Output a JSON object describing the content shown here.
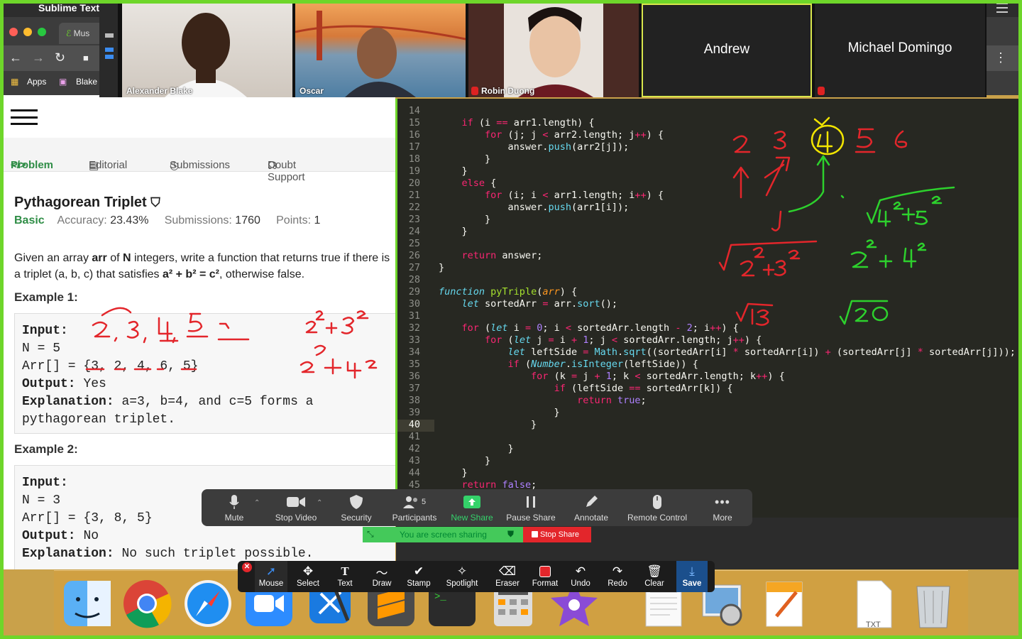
{
  "menubar": {
    "app_name": "Sublime Text"
  },
  "browser": {
    "tab_label_icon": "tab-icon",
    "tab_label": "Mus",
    "bookmarks": [
      "Apps",
      "Blake"
    ]
  },
  "participants": [
    {
      "name": "Alexander Blake",
      "video": true,
      "muted": false
    },
    {
      "name": "Oscar",
      "video": true,
      "muted": false
    },
    {
      "name": "Robin Duong",
      "video": true,
      "muted": true
    },
    {
      "name": "Andrew",
      "video": false,
      "muted": false,
      "active_speaker": true
    },
    {
      "name": "Michael Domingo",
      "video": false,
      "muted": true
    }
  ],
  "problem_page": {
    "tabs": [
      "Problem",
      "Editorial",
      "Submissions",
      "Doubt Support"
    ],
    "title": "Pythagorean Triplet",
    "difficulty": "Basic",
    "accuracy_label": "Accuracy:",
    "accuracy": "23.43%",
    "submissions_label": "Submissions:",
    "submissions": "1760",
    "points_label": "Points:",
    "points": "1",
    "desc_a": "Given an array ",
    "desc_arr": "arr",
    "desc_b": " of ",
    "desc_n": "N",
    "desc_c": " integers, write a function that returns true if there is a triplet (a, b, c) that satisfies ",
    "desc_formula": "a² + b² = c²",
    "desc_d": ", otherwise false.",
    "example1_heading": "Example 1:",
    "example1": {
      "input_label": "Input:",
      "n_line": "N = 5",
      "arr_line": "Arr[] = {3, 2, 4, 6, 5}",
      "output_label": "Output:",
      "output": "Yes",
      "explanation_label": "Explanation:",
      "explanation": "a=3, b=4, and c=5 forms a pythagorean triplet."
    },
    "example2_heading": "Example 2:",
    "example2": {
      "input_label": "Input:",
      "n_line": "N = 3",
      "arr_line": "Arr[] = {3, 8, 5}",
      "output_label": "Output:",
      "output": "No",
      "explanation_label": "Explanation:",
      "explanation": "No such triplet possible."
    }
  },
  "editor": {
    "first_line": 14,
    "current_line": 40,
    "lines": [
      "",
      "    if (i == arr1.length) {",
      "        for (j; j < arr2.length; j++) {",
      "            answer.push(arr2[j]);",
      "        }",
      "    }",
      "    else {",
      "        for (i; i < arr1.length; i++) {",
      "            answer.push(arr1[i]);",
      "        }",
      "    }",
      "",
      "    return answer;",
      "}",
      "",
      "function pyTriple(arr) {",
      "    let sortedArr = arr.sort();",
      "",
      "    for (let i = 0; i < sortedArr.length - 2; i++) {",
      "        for (let j = i + 1; j < sortedArr.length; j++) {",
      "            let leftSide = Math.sqrt((sortedArr[i] * sortedArr[i]) + (sortedArr[j] * sortedArr[j]));",
      "            if (Number.isInteger(leftSide)) {",
      "                for (k = j + 1; k < sortedArr.length; k++) {",
      "                    if (leftSide == sortedArr[k]) {",
      "                        return true;",
      "                    }",
      "                }",
      "",
      "            }",
      "        }",
      "    }",
      "    return false;"
    ]
  },
  "meeting_controls": {
    "mute": "Mute",
    "stop_video": "Stop Video",
    "security": "Security",
    "participants": "Participants",
    "participant_count": "5",
    "new_share": "New Share",
    "pause_share": "Pause Share",
    "annotate": "Annotate",
    "remote_control": "Remote Control",
    "more": "More",
    "sharing_status": "You are screen sharing",
    "stop_share": "Stop Share"
  },
  "annotation_toolbar": [
    "Mouse",
    "Select",
    "Text",
    "Draw",
    "Stamp",
    "Spotlight",
    "Eraser",
    "Format",
    "Undo",
    "Redo",
    "Clear",
    "Save"
  ],
  "dock_items": [
    "Finder",
    "Chrome",
    "Safari",
    "Zoom",
    "Xcode",
    "Sublime Text",
    "Terminal",
    "Calculator",
    "iMovie",
    "TextEdit",
    "Preview",
    "Pages",
    "TXT",
    "Trash"
  ],
  "dock_txt_label": "TXT",
  "annotation_notes": {
    "top_numbers": [
      "2",
      "3",
      "4",
      "5",
      "6"
    ],
    "sqrt1": "√13",
    "sqrt2": "√20",
    "left_sums": [
      "2² + 3²",
      "2² + 4²"
    ]
  },
  "colors": {
    "share_border": "#6ed62a",
    "editor_bg": "#272822",
    "brand_green": "#2f8d46",
    "ink_red": "#e3262b",
    "ink_green": "#2dd12d",
    "ink_yellow": "#f2e500"
  }
}
